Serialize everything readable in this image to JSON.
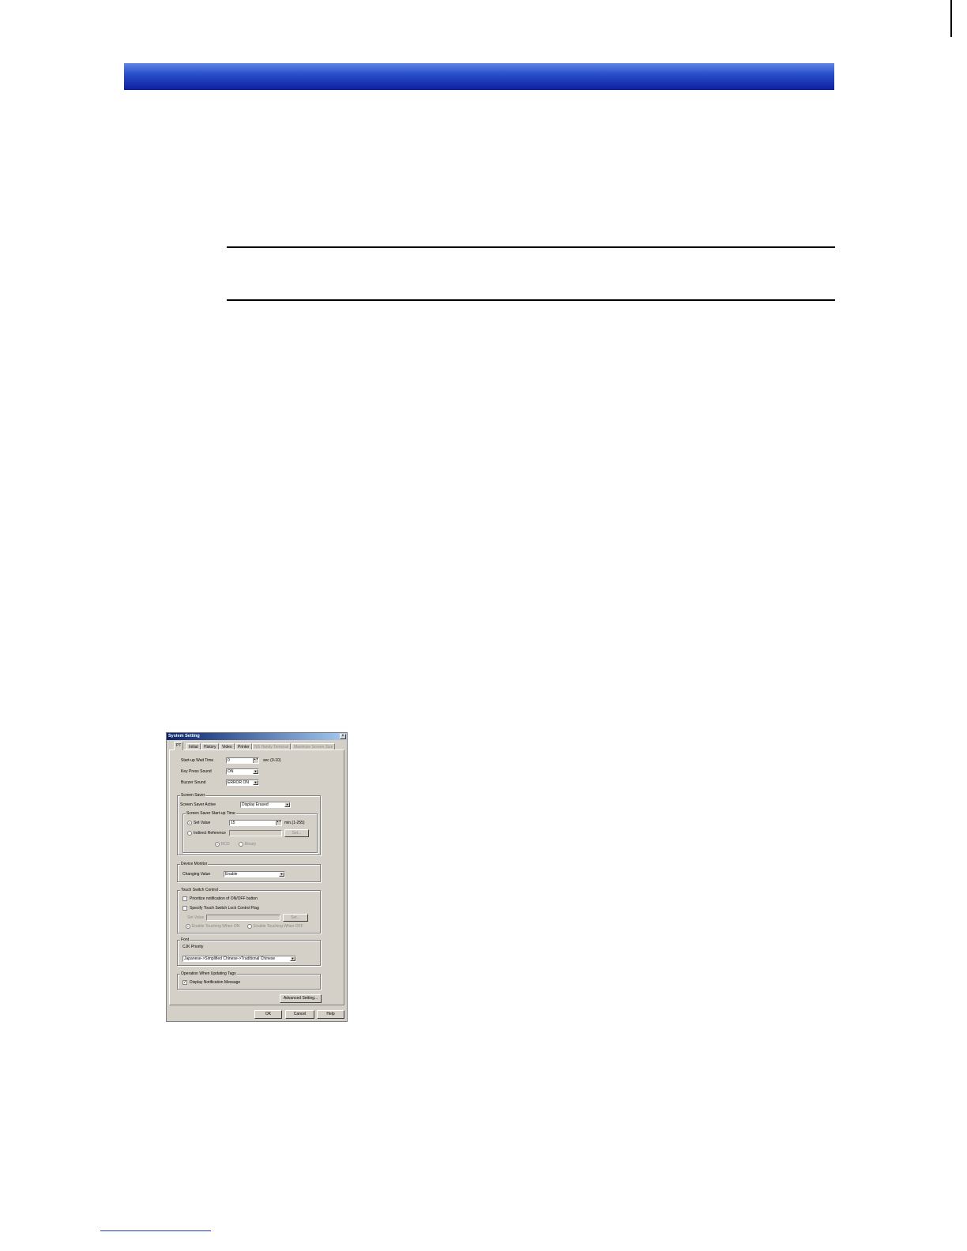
{
  "dialog": {
    "title": "System Setting",
    "close_glyph": "×",
    "tabs": [
      "PT",
      "Initial",
      "History",
      "Video",
      "Printer",
      "NS Handy Terminal",
      "Maximize Screen Size"
    ],
    "pt": {
      "startup_wait_time_label": "Start-up Wait Time",
      "startup_wait_time_value": "0",
      "startup_wait_time_unit": "sec (0-10)",
      "key_press_sound_label": "Key Press Sound",
      "key_press_sound_value": "ON",
      "buzzer_sound_label": "Buzzer Sound",
      "buzzer_sound_value": "ERROR ON"
    },
    "screen_saver": {
      "group_title": "Screen Saver",
      "active_label": "Screen Saver Active",
      "active_value": "Display Erased",
      "startup_group_title": "Screen Saver Start-up Time",
      "set_value_label": "Set Value",
      "set_value_value": "15",
      "set_value_unit": "min.(1-255)",
      "set_value_selected": true,
      "indirect_label": "Indirect Reference",
      "indirect_button": "Set...",
      "bcd_label": "BCD",
      "binary_label": "Binary"
    },
    "device_monitor": {
      "group_title": "Device Monitor",
      "changing_value_label": "Changing Value",
      "changing_value_value": "Enable"
    },
    "touch_switch": {
      "group_title": "Touch Switch Control",
      "prioritize_label": "Prioritize notification of ON/OFF button",
      "specify_label": "Specify Touch Switch Lock Control Flag",
      "set_value_label": "Set Value",
      "set_button": "Set...",
      "enable_on_label": "Enable Touching When ON",
      "enable_off_label": "Enable Touching When OFF"
    },
    "font": {
      "group_title": "Font",
      "cjk_label": "CJK Priority",
      "cjk_value": "Japanese->Simplified Chinese->Traditional Chinese"
    },
    "tags": {
      "group_title": "Operation When Updating Tags",
      "display_notification_label": "Display Notification Message",
      "display_notification_checked": true
    },
    "advanced_button": "Advanced Setting...",
    "ok_button": "OK",
    "cancel_button": "Cancel",
    "help_button": "Help",
    "check_glyph": "✓",
    "dropdown_glyph": "▼",
    "spin_glyph": "▲▼"
  }
}
